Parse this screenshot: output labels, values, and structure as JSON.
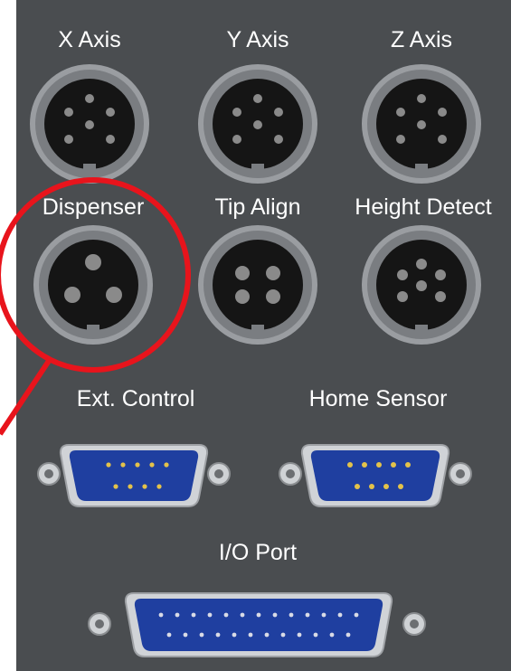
{
  "labels": {
    "x_axis": "X Axis",
    "y_axis": "Y Axis",
    "z_axis": "Z Axis",
    "dispenser": "Dispenser",
    "tip_align": "Tip Align",
    "height_detect": "Height Detect",
    "ext_control": "Ext. Control",
    "home_sensor": "Home Sensor",
    "io_port": "I/O Port"
  },
  "colors": {
    "panel": "#4a4d50",
    "connector_ring": "#8c8f93",
    "connector_face": "#151515",
    "pin": "#8a8a8a",
    "dsub_shell": "#c9ccd0",
    "dsub_body": "#1f3fa0",
    "dsub_pin": "#e3c24a",
    "highlight": "#e8141c"
  },
  "icons": {
    "circular_connector": "circular-connector-icon",
    "dsub_connector": "dsub-connector-icon",
    "thumbscrew": "thumbscrew-icon"
  }
}
